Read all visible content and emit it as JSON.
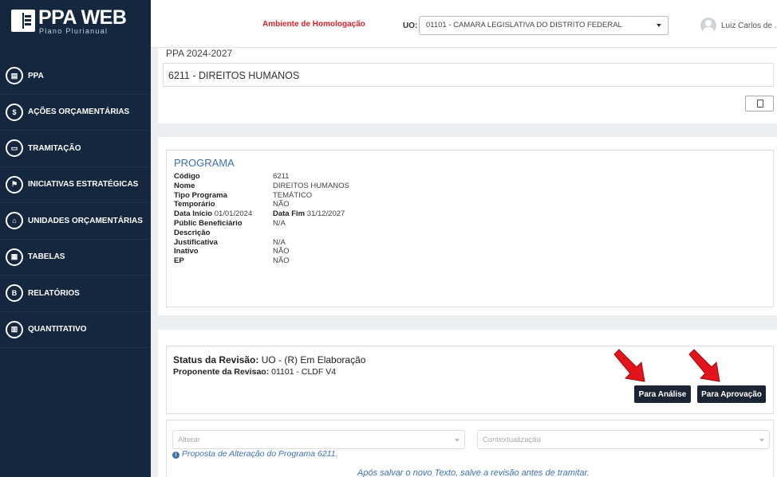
{
  "app": {
    "title": "PPA WEB",
    "subtitle": "Plano Plurianual"
  },
  "sidebar": {
    "items": [
      {
        "label": "PPA",
        "icon": "book-icon"
      },
      {
        "label": "AÇÕES ORÇAMENTÁRIAS",
        "icon": "dollar-icon"
      },
      {
        "label": "TRAMITAÇÃO",
        "icon": "inbox-icon"
      },
      {
        "label": "INICIATIVAS ESTRATÉGICAS",
        "icon": "sitemap-icon"
      },
      {
        "label": "UNIDADES ORÇAMENTÁRIAS",
        "icon": "bank-icon"
      },
      {
        "label": "TABELAS",
        "icon": "table-icon"
      },
      {
        "label": "RELATÓRIOS",
        "icon": "report-icon"
      },
      {
        "label": "QUANTITATIVO",
        "icon": "chart-icon"
      }
    ]
  },
  "topbar": {
    "environment": "Ambiente de Homologação",
    "uo_label": "UO:",
    "uo_value": "01101 - CAMARA LEGISLATIVA DO DISTRITO FEDERAL",
    "user": "Luiz Carlos de ..."
  },
  "header": {
    "ppa": "PPA 2024-2027",
    "program": "6211 - DIREITOS HUMANOS"
  },
  "programa": {
    "title": "PROGRAMA",
    "codigo_label": "Código",
    "codigo": "6211",
    "nome_label": "Nome",
    "nome": "DIREITOS HUMANOS",
    "tipo_label": "Tipo Programa",
    "tipo": "TEMÁTICO",
    "temporario_label": "Temporário",
    "temporario": "NÃO",
    "data_inicio_label": "Data Início",
    "data_inicio": "01/01/2024",
    "data_fim_label": "Data Fim",
    "data_fim": "31/12/2027",
    "publico_label": "Públic Beneficiário",
    "publico": "N/A",
    "descricao_label": "Descrição",
    "descricao": "",
    "justificativa_label": "Justificativa",
    "justificativa": "N/A",
    "inativo_label": "Inativo",
    "inativo": "NÃO",
    "ep_label": "EP",
    "ep": "NÃO"
  },
  "revisao": {
    "status_label": "Status da Revisão:",
    "status_value": "UO - (R) Em Elaboração",
    "proponente_label": "Proponente da Revisao:",
    "proponente_value": "01101 - CLDF V4",
    "btn_analise": "Para Análise",
    "btn_aprovacao": "Para Aprovação",
    "alterar_placeholder": "Alterar",
    "contexto_placeholder": "Contextualização",
    "info_text": "Proposta de Alteração do Programa 6211.",
    "warn_text": "Após salvar o novo Texto, salve a revisão antes de tramitar."
  },
  "colors": {
    "sidebar_bg": "#14273e",
    "environment": "#d9232d",
    "accent": "#3f6fb6",
    "button_dark": "#1a2433",
    "arrow": "#e3141b"
  }
}
